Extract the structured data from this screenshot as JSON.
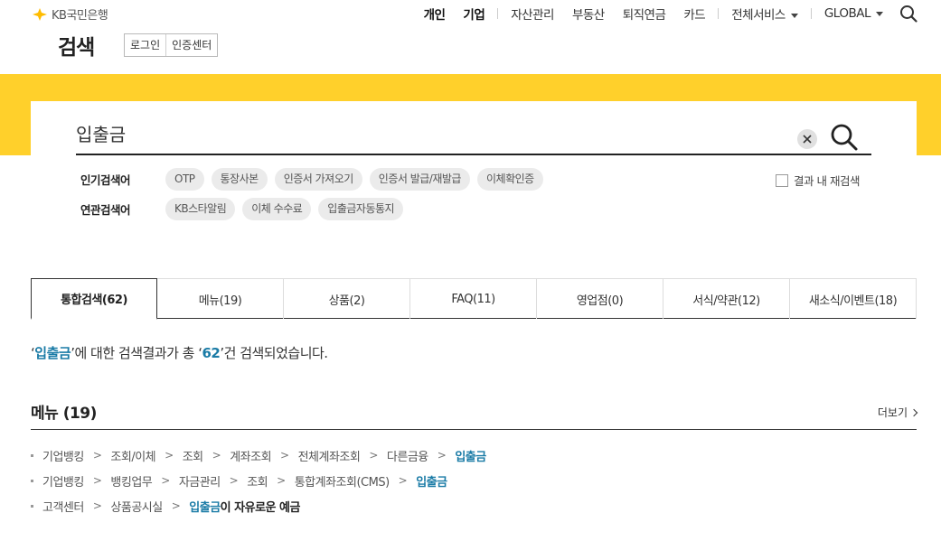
{
  "header": {
    "brand": "KB국민은행",
    "page_title": "검색",
    "login": "로그인",
    "cert_center": "인증센터",
    "gnb": {
      "personal": "개인",
      "business": "기업",
      "asset": "자산관리",
      "realestate": "부동산",
      "pension": "퇴직연금",
      "card": "카드",
      "all_services": "전체서비스",
      "global": "GLOBAL"
    }
  },
  "search": {
    "query": "입출금",
    "popular_label": "인기검색어",
    "related_label": "연관검색어",
    "popular": [
      "OTP",
      "통장사본",
      "인증서 가져오기",
      "인증서 발급/재발급",
      "이체확인증"
    ],
    "related": [
      "KB스타알림",
      "이체 수수료",
      "입출금자동통지"
    ],
    "research_label": "결과 내 재검색"
  },
  "tabs": [
    {
      "label": "통합검색(62)",
      "active": true
    },
    {
      "label": "메뉴(19)"
    },
    {
      "label": "상품(2)"
    },
    {
      "label": "FAQ(11)"
    },
    {
      "label": "영업점(0)"
    },
    {
      "label": "서식/약관(12)"
    },
    {
      "label": "새소식/이벤트(18)"
    }
  ],
  "summary": {
    "q_open": "‘",
    "query": "입출금",
    "mid": "’에 대한 검색결과가 총 ‘",
    "count": "62",
    "end": "’건 검색되었습니다."
  },
  "menu_section": {
    "title": "메뉴 (19)",
    "more": "더보기"
  },
  "menu_results": {
    "r1": [
      "기업뱅킹",
      "조회/이체",
      "조회",
      "계좌조회",
      "전체계좌조회",
      "다른금융",
      "입출금"
    ],
    "r2": [
      "기업뱅킹",
      "뱅킹업무",
      "자금관리",
      "조회",
      "통합계좌조회(CMS)",
      "입출금"
    ],
    "r3": {
      "c1": "고객센터",
      "c2": "상품공시실",
      "hl": "입출금",
      "rest": "이 자유로운 예금"
    }
  },
  "colors": {
    "yellow": "#ffd02b",
    "highlight": "#1a7ba6"
  }
}
